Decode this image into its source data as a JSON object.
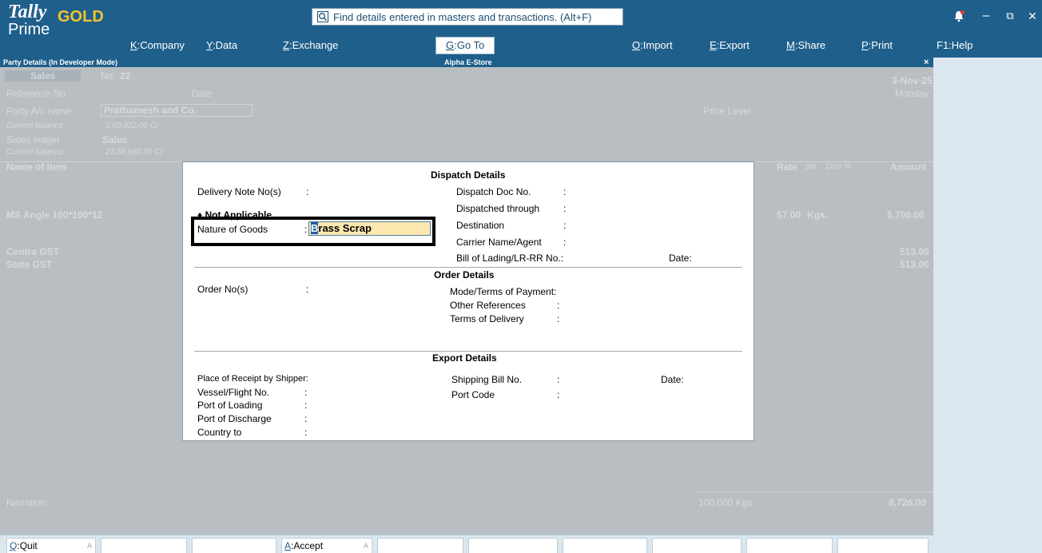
{
  "app": {
    "logo_tally": "Tally",
    "logo_gold": "GOLD",
    "logo_prime": "Prime",
    "search_placeholder": "Find details entered in masters and transactions. (Alt+F)"
  },
  "menu": [
    {
      "key": "K",
      "label": "Company"
    },
    {
      "key": "Y",
      "label": "Data"
    },
    {
      "key": "Z",
      "label": "Exchange"
    },
    {
      "key": "G",
      "label": "Go To"
    },
    {
      "key": "O",
      "label": "Import"
    },
    {
      "key": "E",
      "label": "Export"
    },
    {
      "key": "M",
      "label": "Share"
    },
    {
      "key": "P",
      "label": "Print"
    },
    {
      "key": "F1",
      "label": "Help"
    }
  ],
  "window_controls": {
    "minimize": "–",
    "restore": "⧉",
    "close": "✕"
  },
  "subheader": {
    "left": "Party Details (In Developer Mode)",
    "center": "Alpha E-Store",
    "close": "×"
  },
  "voucher": {
    "type": "Sales",
    "no_label": "No.",
    "no_value": "22",
    "date_value": "3-Nov-25",
    "day_value": "Monday",
    "reference_label": "Reference No",
    "reference_colon": ":",
    "date_label": "Date",
    "date_colon": ":",
    "party_label": "Party A/c name",
    "party_value": "Prathamesh and Co.",
    "current_balance_label": "Current balance",
    "party_balance": "1,60,022.00 Cr",
    "sales_ledger_label": "Sales ledger",
    "sales_ledger_value": "Sales",
    "sales_balance": "23,58,680.39 Cr",
    "price_level_label": "Price Level",
    "price_level_colon": ":",
    "col_name": "Name of Item",
    "col_rate": "Rate",
    "col_per": "per",
    "col_disc": "Disc %",
    "col_amount": "Amount",
    "item_name": "MS Angle 100*100*12",
    "item_rate": "57.00",
    "item_per": "Kgs.",
    "item_amount": "5,700.00",
    "tax1_name": "Centra GST",
    "tax1_amount": "513.00",
    "tax2_name": "State GST",
    "tax2_amount": "513.00",
    "narration_label": "Narration:",
    "total_qty": "100.000 Kgs.",
    "total_amount": "6,726.00"
  },
  "dialog": {
    "dispatch_title": "Dispatch Details",
    "delivery_note_label": "Delivery Note No(s)",
    "not_applicable": "♦ Not Applicable",
    "nature_label": "Nature of Goods",
    "nature_value_first": "B",
    "nature_value_rest": "rass Scrap",
    "dispatch_doc_label": "Dispatch Doc No.",
    "dispatched_through_label": "Dispatched through",
    "destination_label": "Destination",
    "carrier_label": "Carrier Name/Agent",
    "bill_label": "Bill of Lading/LR-RR No.:",
    "date_label": "Date:",
    "order_title": "Order Details",
    "order_no_label": "Order No(s)",
    "mode_terms_label": "Mode/Terms of Payment:",
    "other_ref_label": "Other References",
    "terms_delivery_label": "Terms of Delivery",
    "export_title": "Export Details",
    "place_receipt_label": "Place of Receipt by Shipper:",
    "vessel_label": "Vessel/Flight No.",
    "port_loading_label": "Port of Loading",
    "port_discharge_label": "Port of Discharge",
    "country_label": "Country to",
    "shipping_bill_label": "Shipping Bill No.",
    "port_code_label": "Port Code",
    "export_date_label": "Date:",
    "colon": ":"
  },
  "bottombar": {
    "quit_key": "Q",
    "quit_label": "Quit",
    "accept_key": "A",
    "accept_label": "Accept",
    "caret": "A"
  },
  "colors": {
    "topbar": "#1f5f8b",
    "gold": "#f2c230",
    "input_bg": "#fde9b0",
    "selection": "#1e5fa6"
  }
}
